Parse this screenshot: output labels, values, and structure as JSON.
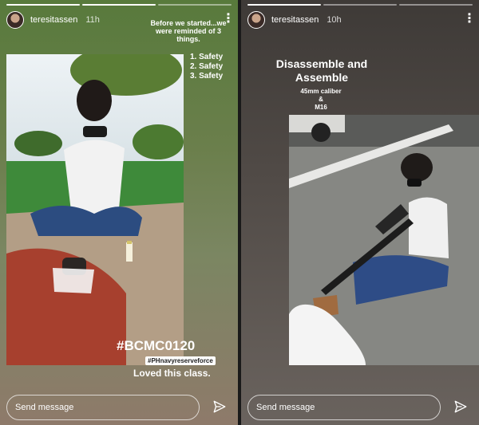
{
  "left_story": {
    "username": "teresitassen",
    "time": "11h",
    "reminder_caption": "Before we started...we were reminded of 3 things.",
    "safety_items": [
      "1. Safety",
      "2. Safety",
      "3. Safety"
    ],
    "hashtag_main": "#BCMC0120",
    "hashtag_secondary": "#PHnavyreserveforce",
    "closing_caption": "Loved this class.",
    "message_placeholder": "Send message"
  },
  "right_story": {
    "username": "teresitassen",
    "time": "10h",
    "title": "Disassemble and Assemble",
    "subtitle_line1": "45mm caliber",
    "subtitle_line2": "&",
    "subtitle_line3": "M16",
    "message_placeholder": "Send message"
  },
  "icons": {
    "more": "more-vertical-icon",
    "send": "send-icon"
  },
  "colors": {
    "left_gradient_top": "#587a3c",
    "right_gradient_top": "#3e3a37",
    "text": "#ffffff"
  }
}
